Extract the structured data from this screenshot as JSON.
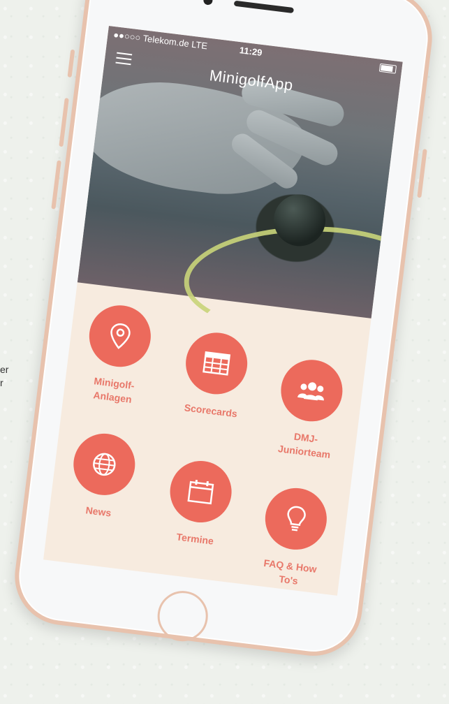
{
  "side_text": [
    "er",
    "r"
  ],
  "status": {
    "carrier": "●●○○○ Telekom.de  LTE",
    "time": "11:29"
  },
  "header": {
    "title": "MinigolfApp",
    "menu_icon": "hamburger-icon"
  },
  "tiles": [
    {
      "label": "Minigolf-\nAnlagen",
      "icon": "location-pin-icon"
    },
    {
      "label": "Scorecards",
      "icon": "table-grid-icon"
    },
    {
      "label": "DMJ-\nJuniorteam",
      "icon": "group-icon"
    },
    {
      "label": "News",
      "icon": "globe-icon"
    },
    {
      "label": "Termine",
      "icon": "calendar-icon"
    },
    {
      "label": "FAQ & How\nTo's",
      "icon": "lightbulb-icon"
    }
  ],
  "colors": {
    "accent": "#ec6a5c",
    "label": "#e8786a",
    "tile_background": "#f7ebdf",
    "phone_frame": "#e8c2ad"
  }
}
